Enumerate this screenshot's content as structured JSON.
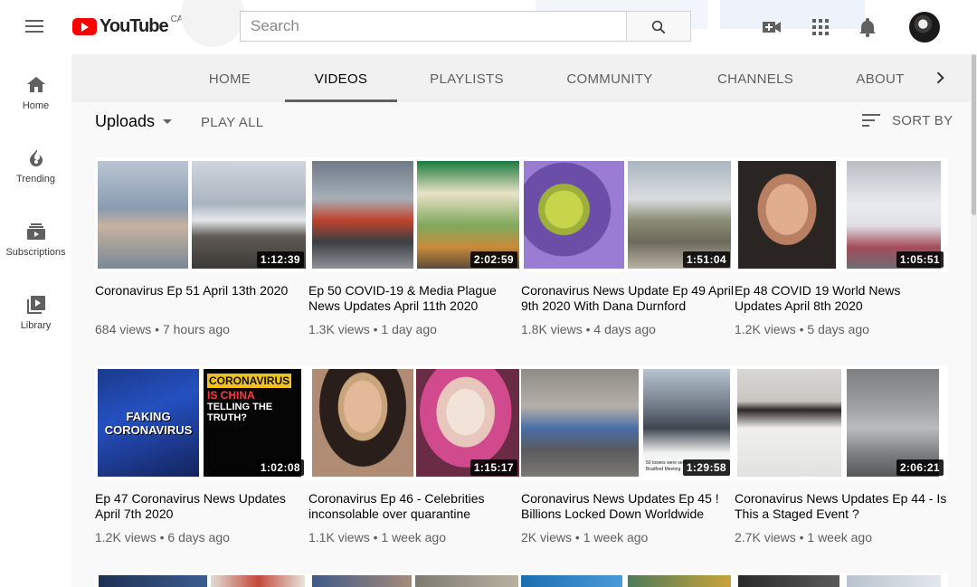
{
  "masthead": {
    "logo_text": "YouTube",
    "country": "CA",
    "search_placeholder": "Search"
  },
  "guide": {
    "items": [
      {
        "label": "Home",
        "icon": "home-icon"
      },
      {
        "label": "Trending",
        "icon": "flame-icon"
      },
      {
        "label": "Subscriptions",
        "icon": "subscriptions-icon"
      },
      {
        "label": "Library",
        "icon": "library-icon"
      }
    ]
  },
  "tabs": [
    {
      "label": "HOME"
    },
    {
      "label": "VIDEOS",
      "active": true
    },
    {
      "label": "PLAYLISTS"
    },
    {
      "label": "COMMUNITY"
    },
    {
      "label": "CHANNELS"
    },
    {
      "label": "ABOUT"
    }
  ],
  "section": {
    "title": "Uploads",
    "play_all": "PLAY ALL",
    "sort_by": "SORT BY"
  },
  "videos": [
    {
      "title": "Coronavirus Ep 51 April 13th 2020",
      "views": "684 views",
      "age": "7 hours ago",
      "duration": "1:12:39"
    },
    {
      "title": "Ep 50 COVID-19 & Media Plague News Updates April 11th 2020",
      "views": "1.3K views",
      "age": "1 day ago",
      "duration": "2:02:59"
    },
    {
      "title": "Coronavirus News Update Ep 49 April 9th 2020 With Dana Durnford",
      "views": "1.8K views",
      "age": "4 days ago",
      "duration": "1:51:04"
    },
    {
      "title": "Ep 48 COVID 19 World News Updates April 8th 2020",
      "views": "1.2K views",
      "age": "5 days ago",
      "duration": "1:05:51"
    },
    {
      "title": "Ep 47 Coronavirus News Updates April 7th 2020",
      "views": "1.2K views",
      "age": "6 days ago",
      "duration": "1:02:08",
      "thumb_text_left": "FAKING CORONAVIRUS",
      "thumb_text_right_1": "CORONAVIRUS",
      "thumb_text_right_2": "IS CHINA",
      "thumb_text_right_3": "TELLING THE",
      "thumb_text_right_4": "TRUTH?"
    },
    {
      "title": "Coronavirus Ep 46 - Celebrities inconsolable over quarantine",
      "views": "1.1K views",
      "age": "1 week ago",
      "duration": "1:15:17"
    },
    {
      "title": "Coronavirus News Updates Ep 45 ! Billions Locked Down Worldwide",
      "views": "2K views",
      "age": "1 week ago",
      "duration": "1:29:58",
      "thumb_caption": "50 towers were sent to Bradford Meeting"
    },
    {
      "title": "Coronavirus News Updates Ep 44 - Is This a Staged Event ?",
      "views": "2.7K views",
      "age": "1 week ago",
      "duration": "2:06:21"
    }
  ],
  "colors": {
    "brand_red": "#ff0000",
    "text_primary": "#030303",
    "text_secondary": "#606060",
    "tabs_bg": "#f1f1f1"
  }
}
